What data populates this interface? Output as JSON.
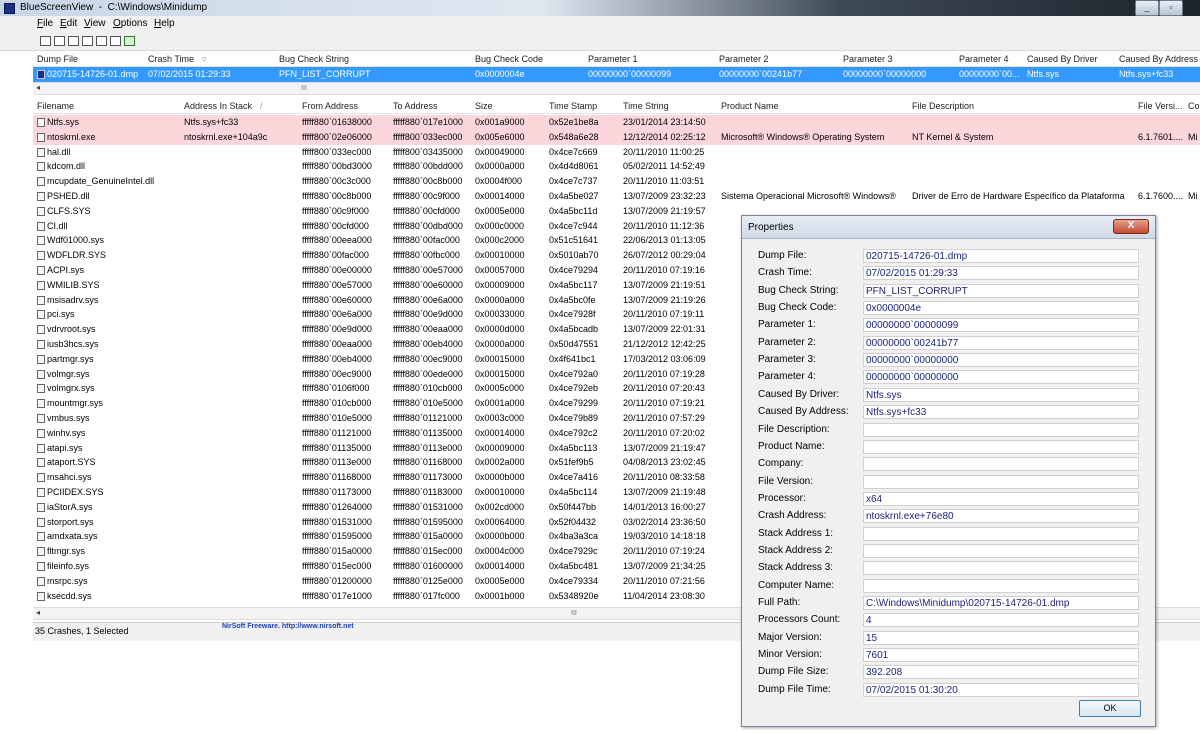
{
  "window": {
    "title": "BlueScreenView  -  C:\\Windows\\Minidump",
    "minimize": "_",
    "restore": "▫",
    "close": "✕"
  },
  "menu": [
    {
      "label": "File",
      "ul": "F",
      "rest": "ile"
    },
    {
      "label": "Edit",
      "ul": "E",
      "rest": "dit"
    },
    {
      "label": "View",
      "ul": "V",
      "rest": "iew"
    },
    {
      "label": "Options",
      "ul": "O",
      "rest": "ptions"
    },
    {
      "label": "Help",
      "ul": "H",
      "rest": "elp"
    }
  ],
  "toolbar_icons": [
    "save-icon",
    "save-all-icon",
    "html-report-icon",
    "copy-icon",
    "properties-icon",
    "find-icon",
    "exit-icon"
  ],
  "upper": {
    "columns": [
      "Dump File",
      "Crash Time",
      "Bug Check String",
      "Bug Check Code",
      "Parameter 1",
      "Parameter 2",
      "Parameter 3",
      "Parameter 4",
      "Caused By Driver",
      "Caused By Address"
    ],
    "sort_arrow": "▿",
    "row": {
      "dump_file": "020715-14726-01.dmp",
      "crash_time": "07/02/2015 01:29:33",
      "bug_check_string": "PFN_LIST_CORRUPT",
      "bug_check_code": "0x0000004e",
      "param1": "00000000`00000099",
      "param2": "00000000`00241b77",
      "param3": "00000000`00000000",
      "param4": "00000000`00...",
      "caused_by_driver": "Ntfs.sys",
      "caused_by_address": "Ntfs.sys+fc33"
    },
    "scroll_grip": "III",
    "scroll_left": "◂"
  },
  "lower": {
    "columns": [
      "Filename",
      "Address In Stack",
      "From Address",
      "To Address",
      "Size",
      "Time Stamp",
      "Time String",
      "Product Name",
      "File Description",
      "File Versi...",
      "Co"
    ],
    "sort_arrow": "/",
    "rows": [
      {
        "f": "Ntfs.sys",
        "a": "Ntfs.sys+fc33",
        "fr": "fffff880`01638000",
        "to": "fffff880`017e1000",
        "sz": "0x001a9000",
        "ts": "0x52e1be8a",
        "tstr": "23/01/2014 23:14:50",
        "pn": "",
        "fd": "",
        "fv": "",
        "co": "",
        "hl": true
      },
      {
        "f": "ntoskrnl.exe",
        "a": "ntoskrnl.exe+104a9c",
        "fr": "fffff800`02e06000",
        "to": "fffff800`033ec000",
        "sz": "0x005e6000",
        "ts": "0x548a6e28",
        "tstr": "12/12/2014 02:25:12",
        "pn": "Microsoft® Windows® Operating System",
        "fd": "NT Kernel & System",
        "fv": "6.1.7601....",
        "co": "Mi",
        "hl": true
      },
      {
        "f": "hal.dll",
        "a": "",
        "fr": "fffff800`033ec000",
        "to": "fffff800`03435000",
        "sz": "0x00049000",
        "ts": "0x4ce7c669",
        "tstr": "20/11/2010 11:00:25",
        "pn": "",
        "fd": "",
        "fv": "",
        "co": ""
      },
      {
        "f": "kdcom.dll",
        "a": "",
        "fr": "fffff880`00bd3000",
        "to": "fffff880`00bdd000",
        "sz": "0x0000a000",
        "ts": "0x4d4d8061",
        "tstr": "05/02/2011 14:52:49",
        "pn": "",
        "fd": "",
        "fv": "",
        "co": ""
      },
      {
        "f": "mcupdate_GenuineIntel.dll",
        "a": "",
        "fr": "fffff880`00c3c000",
        "to": "fffff880`00c8b000",
        "sz": "0x0004f000",
        "ts": "0x4ce7c737",
        "tstr": "20/11/2010 11:03:51",
        "pn": "",
        "fd": "",
        "fv": "",
        "co": ""
      },
      {
        "f": "PSHED.dll",
        "a": "",
        "fr": "fffff880`00c8b000",
        "to": "fffff880`00c9f000",
        "sz": "0x00014000",
        "ts": "0x4a5be027",
        "tstr": "13/07/2009 23:32:23",
        "pn": "Sistema Operacional Microsoft® Windows®",
        "fd": "Driver de Erro de Hardware Específico da Plataforma",
        "fv": "6.1.7600....",
        "co": "Mi"
      },
      {
        "f": "CLFS.SYS",
        "a": "",
        "fr": "fffff880`00c9f000",
        "to": "fffff880`00cfd000",
        "sz": "0x0005e000",
        "ts": "0x4a5bc11d",
        "tstr": "13/07/2009 21:19:57",
        "pn": "",
        "fd": "",
        "fv": "",
        "co": ""
      },
      {
        "f": "CI.dll",
        "a": "",
        "fr": "fffff880`00cfd000",
        "to": "fffff880`00dbd000",
        "sz": "0x000c0000",
        "ts": "0x4ce7c944",
        "tstr": "20/11/2010 11:12:36",
        "pn": "",
        "fd": "",
        "fv": "",
        "co": ""
      },
      {
        "f": "Wdf01000.sys",
        "a": "",
        "fr": "fffff880`00eea000",
        "to": "fffff880`00fac000",
        "sz": "0x000c2000",
        "ts": "0x51c51641",
        "tstr": "22/06/2013 01:13:05",
        "pn": "",
        "fd": "",
        "fv": "",
        "co": ""
      },
      {
        "f": "WDFLDR.SYS",
        "a": "",
        "fr": "fffff880`00fac000",
        "to": "fffff880`00fbc000",
        "sz": "0x00010000",
        "ts": "0x5010ab70",
        "tstr": "26/07/2012 00:29:04",
        "pn": "",
        "fd": "",
        "fv": "",
        "co": ""
      },
      {
        "f": "ACPI.sys",
        "a": "",
        "fr": "fffff880`00e00000",
        "to": "fffff880`00e57000",
        "sz": "0x00057000",
        "ts": "0x4ce79294",
        "tstr": "20/11/2010 07:19:16",
        "pn": "",
        "fd": "",
        "fv": "",
        "co": ""
      },
      {
        "f": "WMILIB.SYS",
        "a": "",
        "fr": "fffff880`00e57000",
        "to": "fffff880`00e60000",
        "sz": "0x00009000",
        "ts": "0x4a5bc117",
        "tstr": "13/07/2009 21:19:51",
        "pn": "",
        "fd": "",
        "fv": "",
        "co": ""
      },
      {
        "f": "msisadrv.sys",
        "a": "",
        "fr": "fffff880`00e60000",
        "to": "fffff880`00e6a000",
        "sz": "0x0000a000",
        "ts": "0x4a5bc0fe",
        "tstr": "13/07/2009 21:19:26",
        "pn": "",
        "fd": "",
        "fv": "",
        "co": ""
      },
      {
        "f": "pci.sys",
        "a": "",
        "fr": "fffff880`00e6a000",
        "to": "fffff880`00e9d000",
        "sz": "0x00033000",
        "ts": "0x4ce7928f",
        "tstr": "20/11/2010 07:19:11",
        "pn": "",
        "fd": "",
        "fv": "",
        "co": ""
      },
      {
        "f": "vdrvroot.sys",
        "a": "",
        "fr": "fffff880`00e9d000",
        "to": "fffff880`00eaa000",
        "sz": "0x0000d000",
        "ts": "0x4a5bcadb",
        "tstr": "13/07/2009 22:01:31",
        "pn": "",
        "fd": "",
        "fv": "",
        "co": ""
      },
      {
        "f": "iusb3hcs.sys",
        "a": "",
        "fr": "fffff880`00eaa000",
        "to": "fffff880`00eb4000",
        "sz": "0x0000a000",
        "ts": "0x50d47551",
        "tstr": "21/12/2012 12:42:25",
        "pn": "",
        "fd": "",
        "fv": "",
        "co": ""
      },
      {
        "f": "partmgr.sys",
        "a": "",
        "fr": "fffff880`00eb4000",
        "to": "fffff880`00ec9000",
        "sz": "0x00015000",
        "ts": "0x4f641bc1",
        "tstr": "17/03/2012 03:06:09",
        "pn": "",
        "fd": "",
        "fv": "",
        "co": ""
      },
      {
        "f": "volmgr.sys",
        "a": "",
        "fr": "fffff880`00ec9000",
        "to": "fffff880`00ede000",
        "sz": "0x00015000",
        "ts": "0x4ce792a0",
        "tstr": "20/11/2010 07:19:28",
        "pn": "",
        "fd": "",
        "fv": "",
        "co": ""
      },
      {
        "f": "volmgrx.sys",
        "a": "",
        "fr": "fffff880`0106f000",
        "to": "fffff880`010cb000",
        "sz": "0x0005c000",
        "ts": "0x4ce792eb",
        "tstr": "20/11/2010 07:20:43",
        "pn": "",
        "fd": "",
        "fv": "",
        "co": ""
      },
      {
        "f": "mountmgr.sys",
        "a": "",
        "fr": "fffff880`010cb000",
        "to": "fffff880`010e5000",
        "sz": "0x0001a000",
        "ts": "0x4ce79299",
        "tstr": "20/11/2010 07:19:21",
        "pn": "",
        "fd": "",
        "fv": "",
        "co": ""
      },
      {
        "f": "vmbus.sys",
        "a": "",
        "fr": "fffff880`010e5000",
        "to": "fffff880`01121000",
        "sz": "0x0003c000",
        "ts": "0x4ce79b89",
        "tstr": "20/11/2010 07:57:29",
        "pn": "",
        "fd": "",
        "fv": "",
        "co": ""
      },
      {
        "f": "winhv.sys",
        "a": "",
        "fr": "fffff880`01121000",
        "to": "fffff880`01135000",
        "sz": "0x00014000",
        "ts": "0x4ce792c2",
        "tstr": "20/11/2010 07:20:02",
        "pn": "",
        "fd": "",
        "fv": "",
        "co": ""
      },
      {
        "f": "atapi.sys",
        "a": "",
        "fr": "fffff880`01135000",
        "to": "fffff880`0113e000",
        "sz": "0x00009000",
        "ts": "0x4a5bc113",
        "tstr": "13/07/2009 21:19:47",
        "pn": "",
        "fd": "",
        "fv": "",
        "co": ""
      },
      {
        "f": "ataport.SYS",
        "a": "",
        "fr": "fffff880`0113e000",
        "to": "fffff880`01168000",
        "sz": "0x0002a000",
        "ts": "0x51fef9b5",
        "tstr": "04/08/2013 23:02:45",
        "pn": "",
        "fd": "",
        "fv": "",
        "co": ""
      },
      {
        "f": "msahci.sys",
        "a": "",
        "fr": "fffff880`01168000",
        "to": "fffff880`01173000",
        "sz": "0x0000b000",
        "ts": "0x4ce7a416",
        "tstr": "20/11/2010 08:33:58",
        "pn": "",
        "fd": "",
        "fv": "",
        "co": ""
      },
      {
        "f": "PCIIDEX.SYS",
        "a": "",
        "fr": "fffff880`01173000",
        "to": "fffff880`01183000",
        "sz": "0x00010000",
        "ts": "0x4a5bc114",
        "tstr": "13/07/2009 21:19:48",
        "pn": "",
        "fd": "",
        "fv": "",
        "co": ""
      },
      {
        "f": "iaStorA.sys",
        "a": "",
        "fr": "fffff880`01264000",
        "to": "fffff880`01531000",
        "sz": "0x002cd000",
        "ts": "0x50f447bb",
        "tstr": "14/01/2013 16:00:27",
        "pn": "",
        "fd": "",
        "fv": "",
        "co": ""
      },
      {
        "f": "storport.sys",
        "a": "",
        "fr": "fffff880`01531000",
        "to": "fffff880`01595000",
        "sz": "0x00064000",
        "ts": "0x52f04432",
        "tstr": "03/02/2014 23:36:50",
        "pn": "",
        "fd": "",
        "fv": "",
        "co": ""
      },
      {
        "f": "amdxata.sys",
        "a": "",
        "fr": "fffff880`01595000",
        "to": "fffff880`015a0000",
        "sz": "0x0000b000",
        "ts": "0x4ba3a3ca",
        "tstr": "19/03/2010 14:18:18",
        "pn": "",
        "fd": "",
        "fv": "",
        "co": ""
      },
      {
        "f": "fltmgr.sys",
        "a": "",
        "fr": "fffff880`015a0000",
        "to": "fffff880`015ec000",
        "sz": "0x0004c000",
        "ts": "0x4ce7929c",
        "tstr": "20/11/2010 07:19:24",
        "pn": "",
        "fd": "",
        "fv": "",
        "co": ""
      },
      {
        "f": "fileinfo.sys",
        "a": "",
        "fr": "fffff880`015ec000",
        "to": "fffff880`01600000",
        "sz": "0x00014000",
        "ts": "0x4a5bc481",
        "tstr": "13/07/2009 21:34:25",
        "pn": "",
        "fd": "",
        "fv": "",
        "co": ""
      },
      {
        "f": "msrpc.sys",
        "a": "",
        "fr": "fffff880`01200000",
        "to": "fffff880`0125e000",
        "sz": "0x0005e000",
        "ts": "0x4ce79334",
        "tstr": "20/11/2010 07:21:56",
        "pn": "",
        "fd": "",
        "fv": "",
        "co": ""
      },
      {
        "f": "ksecdd.sys",
        "a": "",
        "fr": "fffff880`017e1000",
        "to": "fffff880`017fc000",
        "sz": "0x0001b000",
        "ts": "0x5348920e",
        "tstr": "11/04/2014 23:08:30",
        "pn": "",
        "fd": "",
        "fv": "",
        "co": ""
      }
    ],
    "scroll_grip": "III",
    "scroll_left": "◂"
  },
  "status": {
    "count": "35 Crashes, 1 Selected",
    "credit": "NirSoft Freeware.  http://www.nirsoft.net"
  },
  "dialog": {
    "title": "Properties",
    "close": "X",
    "ok": "OK",
    "fields": [
      {
        "label": "Dump File:",
        "value": "020715-14726-01.dmp"
      },
      {
        "label": "Crash Time:",
        "value": "07/02/2015 01:29:33"
      },
      {
        "label": "Bug Check String:",
        "value": "PFN_LIST_CORRUPT"
      },
      {
        "label": "Bug Check Code:",
        "value": "0x0000004e"
      },
      {
        "label": "Parameter 1:",
        "value": "00000000`00000099"
      },
      {
        "label": "Parameter 2:",
        "value": "00000000`00241b77"
      },
      {
        "label": "Parameter 3:",
        "value": "00000000`00000000"
      },
      {
        "label": "Parameter 4:",
        "value": "00000000`00000000"
      },
      {
        "label": "Caused By Driver:",
        "value": "Ntfs.sys"
      },
      {
        "label": "Caused By Address:",
        "value": "Ntfs.sys+fc33"
      },
      {
        "label": "File Description:",
        "value": ""
      },
      {
        "label": "Product Name:",
        "value": ""
      },
      {
        "label": "Company:",
        "value": ""
      },
      {
        "label": "File Version:",
        "value": ""
      },
      {
        "label": "Processor:",
        "value": "x64"
      },
      {
        "label": "Crash Address:",
        "value": "ntoskrnl.exe+76e80"
      },
      {
        "label": "Stack Address 1:",
        "value": ""
      },
      {
        "label": "Stack Address 2:",
        "value": ""
      },
      {
        "label": "Stack Address 3:",
        "value": ""
      },
      {
        "label": "Computer Name:",
        "value": ""
      },
      {
        "label": "Full Path:",
        "value": "C:\\Windows\\Minidump\\020715-14726-01.dmp"
      },
      {
        "label": "Processors Count:",
        "value": "4"
      },
      {
        "label": "Major Version:",
        "value": "15"
      },
      {
        "label": "Minor Version:",
        "value": "7601"
      },
      {
        "label": "Dump File Size:",
        "value": "392.208"
      },
      {
        "label": "Dump File Time:",
        "value": "07/02/2015 01:30:20"
      }
    ]
  },
  "colors": {
    "selected_row": "#3399ff",
    "highlight_row": "#fbd7dc",
    "field_text": "#1a237e"
  }
}
